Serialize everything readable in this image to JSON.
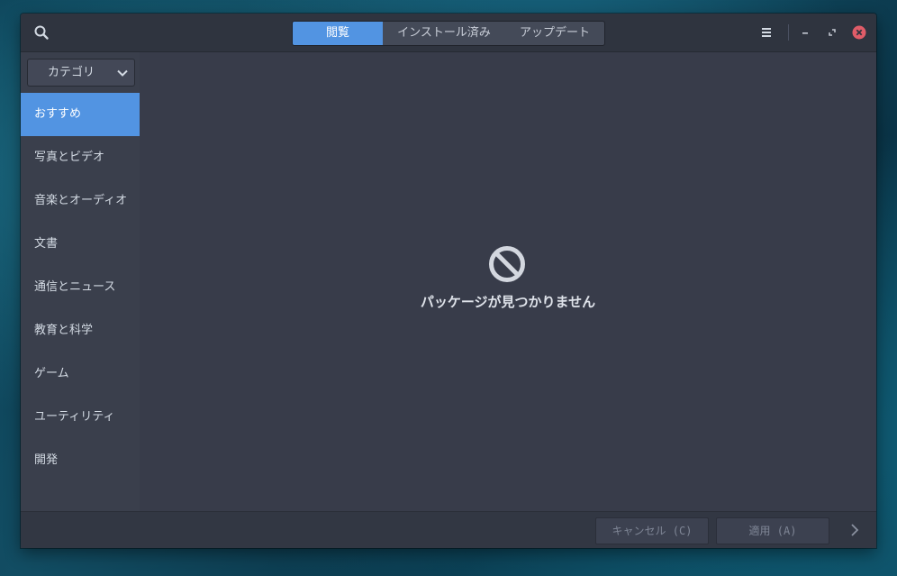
{
  "header": {
    "tabs": [
      {
        "label": "閲覧",
        "active": true
      },
      {
        "label": "インストール済み",
        "active": false
      },
      {
        "label": "アップデート",
        "active": false
      }
    ]
  },
  "sidebar": {
    "category_select": "カテゴリ",
    "items": [
      {
        "label": "おすすめ",
        "selected": true
      },
      {
        "label": "写真とビデオ"
      },
      {
        "label": "音楽とオーディオ"
      },
      {
        "label": "文書"
      },
      {
        "label": "通信とニュース"
      },
      {
        "label": "教育と科学"
      },
      {
        "label": "ゲーム"
      },
      {
        "label": "ユーティリティ"
      },
      {
        "label": "開発"
      }
    ]
  },
  "main": {
    "empty_message": "パッケージが見つかりません",
    "empty_icon": "no-entry-icon"
  },
  "footer": {
    "cancel_label": "キャンセル (C)",
    "apply_label": "適用 (A)"
  },
  "colors": {
    "accent": "#5294e2",
    "close": "#e05c68",
    "window_bg": "#383c4a",
    "sidebar_bg": "#3a3f4c"
  }
}
